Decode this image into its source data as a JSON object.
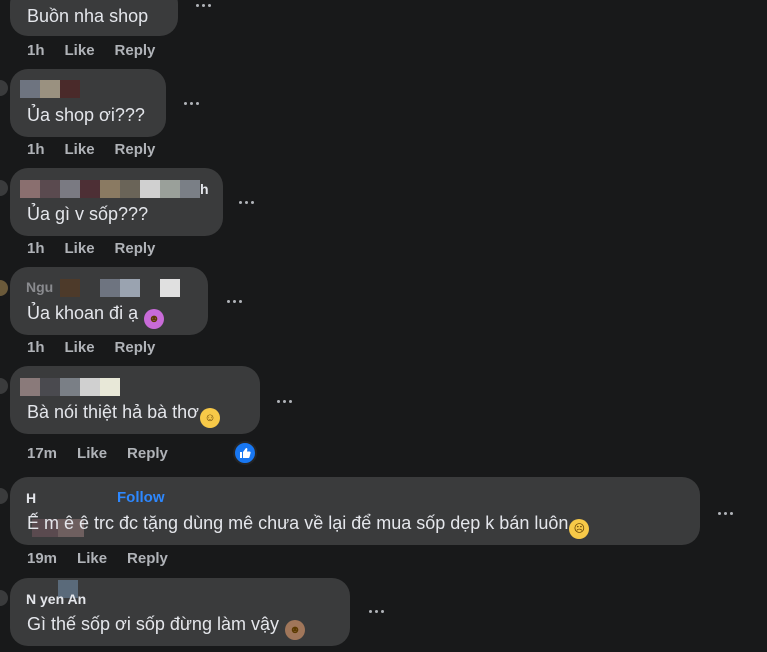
{
  "labels": {
    "like": "Like",
    "reply": "Reply",
    "follow": "Follow"
  },
  "comments": [
    {
      "name": "",
      "text": "Buồn nha shop",
      "time": "1h"
    },
    {
      "name": "",
      "text": "Ủa shop ơi???",
      "time": "1h"
    },
    {
      "name": "",
      "text": "Ủa gì v sốp???",
      "time": "1h"
    },
    {
      "name": "Ngu",
      "text": "Ủa khoan đi ạ",
      "time": "1h",
      "emoji": "devil-face-icon"
    },
    {
      "name": "",
      "text": "Bà nói thiệt hả bà thơ",
      "time": "17m",
      "emoji": "crying-smile-icon",
      "reactions": "like-reaction-icon"
    },
    {
      "name": "H",
      "text": "Ế m ê ê trc đc tặng dùng mê chưa về lại để mua sốp dẹp k bán luôn",
      "time": "19m",
      "emoji": "eye-roll-face-icon"
    },
    {
      "name": "N   yen An",
      "text": "Gì thế sốp ơi sốp đừng làm vậy",
      "time": "",
      "emoji": "monkey-face-icon"
    }
  ],
  "colors": {
    "background": "#18191a",
    "bubble": "#3a3b3c",
    "text": "#e4e6eb",
    "meta": "#b0b3b8",
    "link": "#2d88ff",
    "like_badge": "#1877f2"
  }
}
